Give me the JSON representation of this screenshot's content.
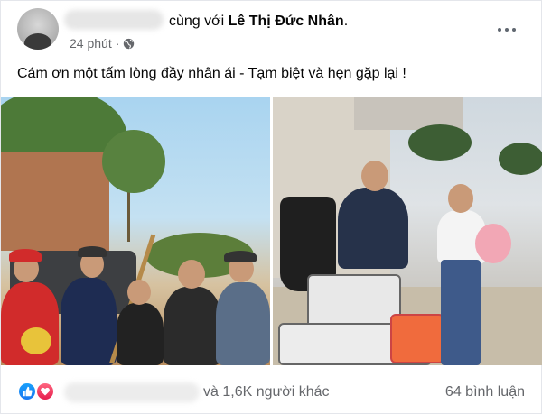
{
  "post": {
    "with_text": "cùng với",
    "tagged_name": "Lê Thị Đức Nhân",
    "tagged_suffix": ".",
    "time": "24 phút",
    "separator": "·",
    "privacy_icon": "globe-icon",
    "caption": "Cám ơn một tấm lòng đầy nhân ái - Tạm biệt và hẹn gặp lại !"
  },
  "reactions": {
    "icons": [
      "like-icon",
      "love-icon"
    ],
    "others_text": "và 1,6K người khác",
    "comments_text": "64 bình luận"
  },
  "colors": {
    "like_blue": "#1877f2",
    "love_red": "#e61e4d",
    "meta_gray": "#65676b"
  }
}
